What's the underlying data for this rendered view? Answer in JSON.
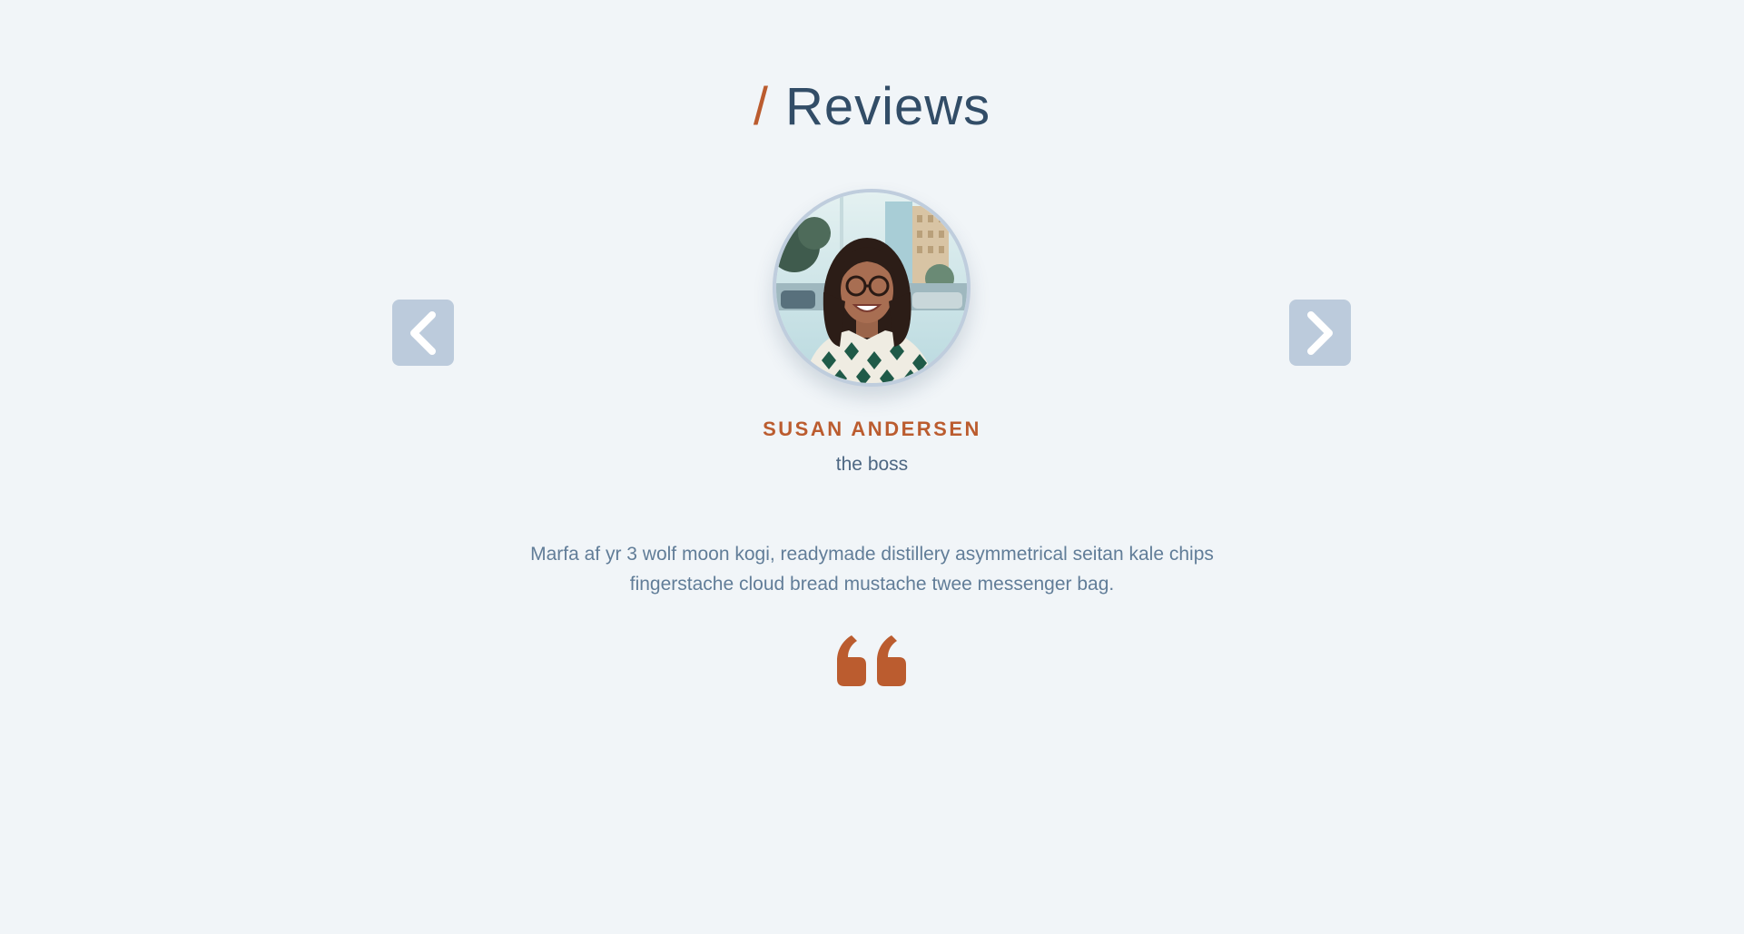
{
  "header": {
    "slash": "/",
    "title": "Reviews"
  },
  "navigation": {
    "prev_icon": "chevron-left-icon",
    "next_icon": "chevron-right-icon"
  },
  "review": {
    "name": "susan andersen",
    "job": "the boss",
    "text": "Marfa af yr 3 wolf moon kogi, readymade distillery asymmetrical seitan kale chips fingerstache cloud bread mustache twee messenger bag.",
    "quote_icon": "quote-left-icon"
  },
  "colors": {
    "background": "#f1f5f8",
    "accent": "#bb5c2f",
    "title": "#324d67",
    "nav_button": "#bccbdc",
    "text": "#617d98"
  }
}
